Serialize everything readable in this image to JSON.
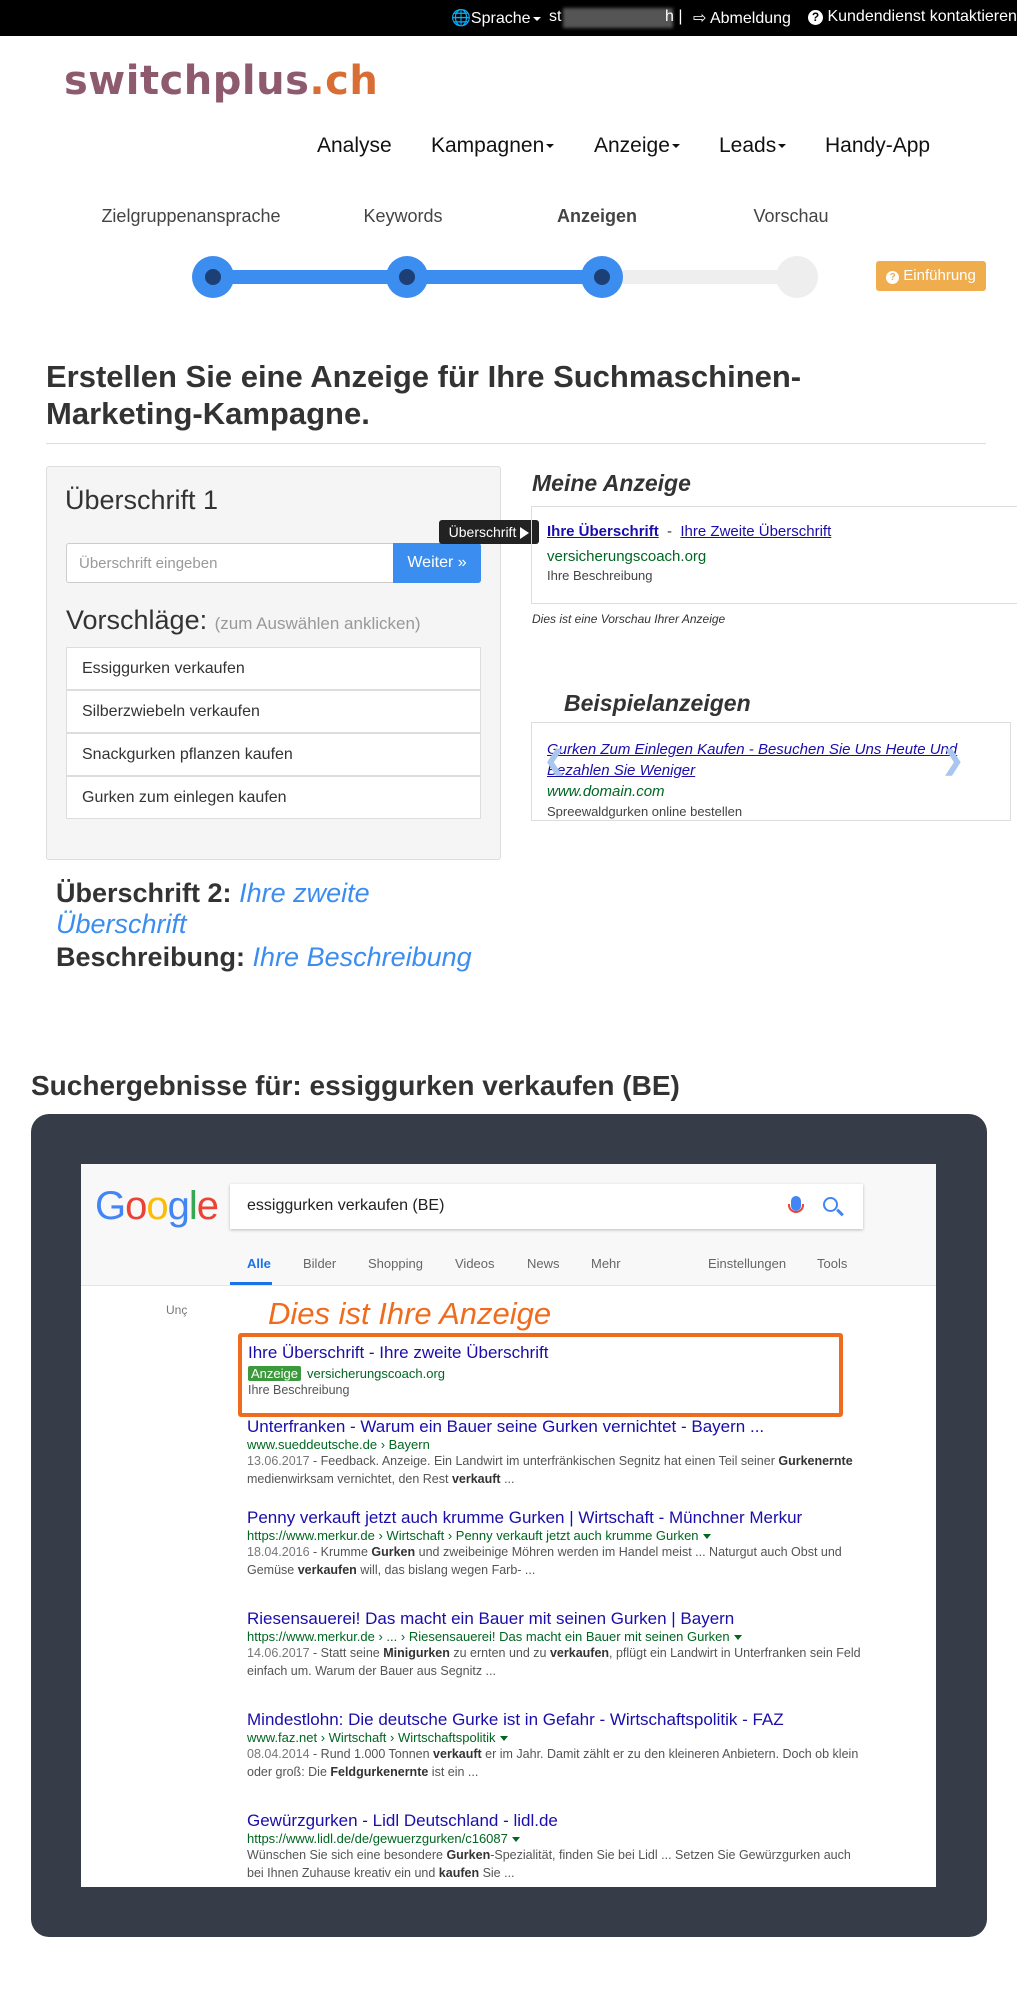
{
  "topbar": {
    "language": "Sprache",
    "user_visible": "st",
    "user_end": "h |",
    "logout": "Abmeldung",
    "support": "Kundendienst kontaktieren"
  },
  "logo": {
    "part1": "switchplus",
    "part2": ".ch"
  },
  "nav": {
    "analyse": "Analyse",
    "kampagnen": "Kampagnen",
    "anzeige": "Anzeige",
    "leads": "Leads",
    "app": "Handy-App"
  },
  "steps": {
    "labels": [
      "Zielgruppenansprache",
      "Keywords",
      "Anzeigen",
      "Vorschau"
    ],
    "active_index": 2,
    "completed": 3,
    "colors": {
      "done": "#3b8df0",
      "todo": "#eeeeee"
    },
    "intro_button": "Einführung"
  },
  "page_title": "Erstellen Sie eine Anzeige für Ihre Suchmaschinen-Marketing-Kampagne.",
  "form": {
    "heading": "Überschrift 1",
    "placeholder": "Überschrift eingeben",
    "next_button": "Weiter »",
    "suggestions_heading": "Vorschläge:",
    "suggestions_hint": "(zum Auswählen anklicken)",
    "suggestions": [
      "Essiggurken verkaufen",
      "Silberzwiebeln verkaufen",
      "Snackgurken pflanzen kaufen",
      "Gurken zum einlegen kaufen"
    ],
    "tooltip": "Überschrift"
  },
  "summary": {
    "h2_label": "Überschrift 2:",
    "h2_value": "Ihre zweite Überschrift",
    "desc_label": "Beschreibung:",
    "desc_value": "Ihre Beschreibung"
  },
  "my_ad": {
    "heading": "Meine Anzeige",
    "title1": "Ihre Überschrift",
    "sep": "-",
    "title2": "Ihre Zweite Überschrift",
    "url": "versicherungscoach.org",
    "desc": "Ihre Beschreibung",
    "note": "Dies ist eine Vorschau Ihrer Anzeige"
  },
  "example": {
    "heading": "Beispielanzeigen",
    "title": "Gurken Zum Einlegen Kaufen - Besuchen Sie Uns Heute Und Bezahlen Sie Weniger",
    "url": "www.domain.com",
    "desc": "Spreewaldgurken online bestellen"
  },
  "results_heading": "Suchergebnisse für: essiggurken verkaufen (BE)",
  "google": {
    "query": "essiggurken verkaufen  (BE)",
    "tabs": [
      "Alle",
      "Bilder",
      "Shopping",
      "Videos",
      "News",
      "Mehr"
    ],
    "tabs_right": [
      "Einstellungen",
      "Tools"
    ],
    "partial": "Unç",
    "overlay_text": "Dies ist Ihre Anzeige",
    "ad": {
      "title": "Ihre Überschrift - Ihre zweite Überschrift",
      "badge": "Anzeige",
      "url": "versicherungscoach.org",
      "desc": "Ihre Beschreibung"
    },
    "results": [
      {
        "title": "Unterfranken - Warum ein Bauer seine Gurken vernichtet - Bayern ...",
        "url": "www.sueddeutsche.de › Bayern",
        "date": "13.06.2017",
        "snippet_a": " - Feedback. Anzeige. Ein Landwirt im unterfränkischen Segnitz hat einen Teil seiner ",
        "bold1": "Gurkenernte",
        "snippet_b": " medienwirksam vernichtet, den Rest ",
        "bold2": "verkauft",
        "snippet_c": " ..."
      },
      {
        "title": "Penny verkauft jetzt auch krumme Gurken | Wirtschaft - Münchner Merkur",
        "url": "https://www.merkur.de › Wirtschaft › Penny verkauft jetzt auch krumme Gurken",
        "date": "18.04.2016",
        "snippet_a": " - Krumme ",
        "bold1": "Gurken",
        "snippet_b": " und zweibeinige Möhren werden im Handel meist ... Naturgut auch Obst und Gemüse ",
        "bold2": "verkaufen",
        "snippet_c": " will, das bislang wegen Farb- ..."
      },
      {
        "title": "Riesensauerei! Das macht ein Bauer mit seinen Gurken | Bayern",
        "url": "https://www.merkur.de › ... › Riesensauerei! Das macht ein Bauer mit seinen Gurken",
        "date": "14.06.2017",
        "snippet_a": " - Statt seine ",
        "bold1": "Minigurken",
        "snippet_b": " zu ernten und zu ",
        "bold2": "verkaufen",
        "snippet_c": ", pflügt ein Landwirt in Unterfranken sein Feld einfach um. Warum der Bauer aus Segnitz ..."
      },
      {
        "title": "Mindestlohn: Die deutsche Gurke ist in Gefahr - Wirtschaftspolitik - FAZ",
        "url": "www.faz.net › Wirtschaft › Wirtschaftspolitik",
        "date": "08.04.2014",
        "snippet_a": " - Rund 1.000 Tonnen ",
        "bold1": "verkauft",
        "snippet_b": " er im Jahr. Damit zählt er zu den kleineren Anbietern. Doch ob klein oder groß: Die ",
        "bold2": "Feldgurkenernte",
        "snippet_c": " ist ein ..."
      },
      {
        "title": "Gewürzgurken - Lidl Deutschland - lidl.de",
        "url": "https://www.lidl.de/de/gewuerzgurken/c16087",
        "date": "",
        "snippet_a": "Wünschen Sie sich eine besondere ",
        "bold1": "Gurken",
        "snippet_b": "-Spezialität, finden Sie bei Lidl ... Setzen Sie Gewürzgurken auch bei Ihnen Zuhause kreativ ein und ",
        "bold2": "kaufen",
        "snippet_c": " Sie ..."
      }
    ]
  }
}
